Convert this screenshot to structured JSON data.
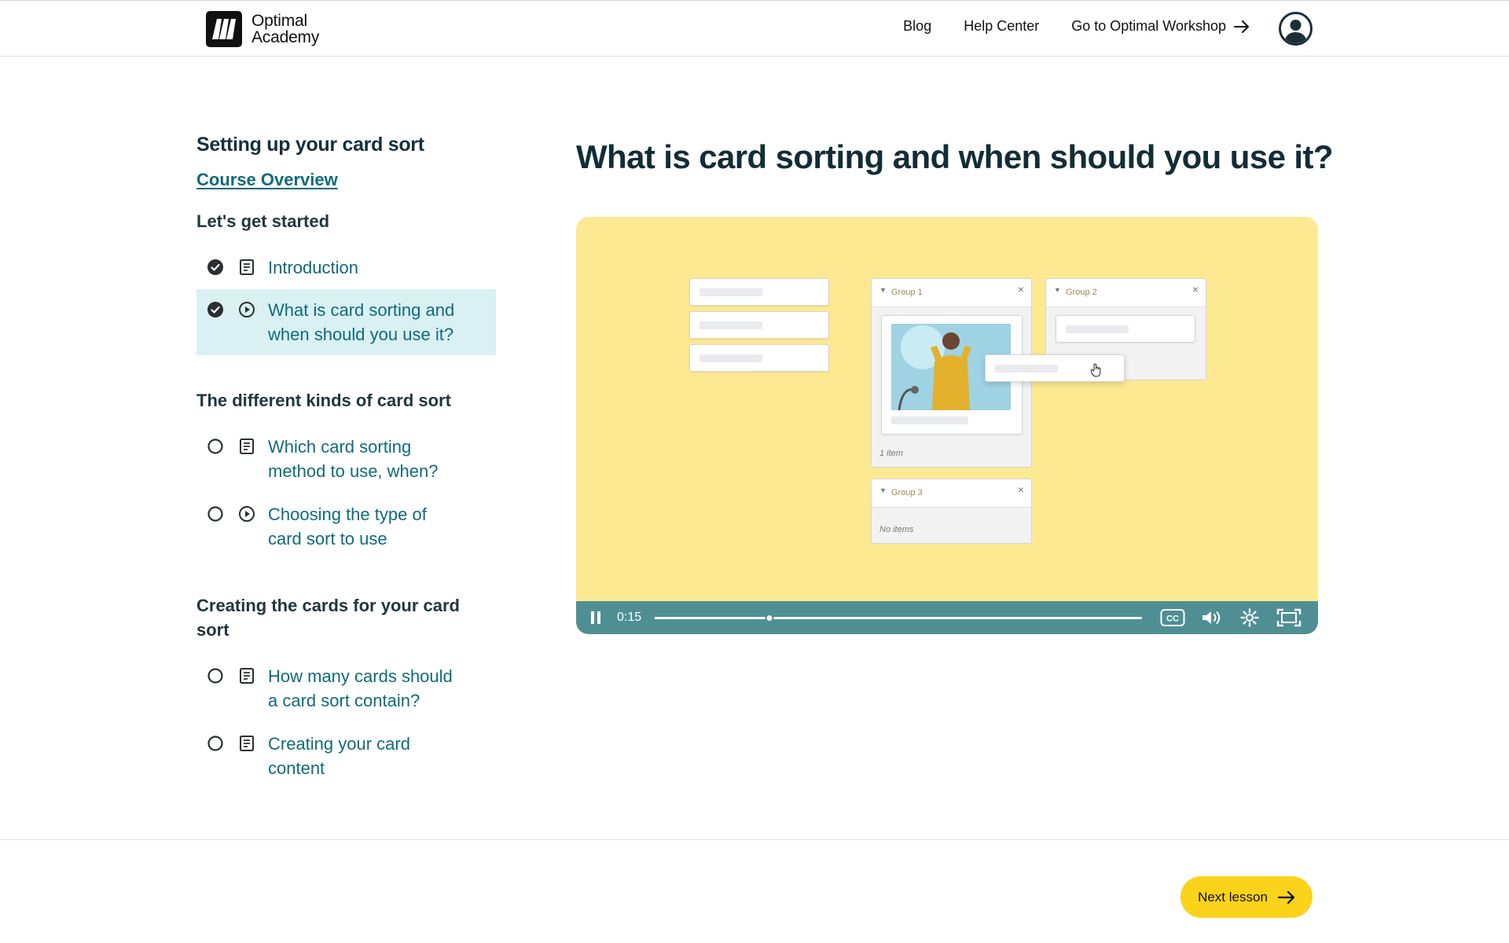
{
  "header": {
    "logo_line1": "Optimal",
    "logo_line2": "Academy",
    "nav": [
      {
        "label": "Blog"
      },
      {
        "label": "Help Center"
      },
      {
        "label": "Go to Optimal Workshop"
      }
    ]
  },
  "sidebar": {
    "course_title": "Setting up your card sort",
    "overview_link": "Course Overview",
    "sections": [
      {
        "title": "Let's get started",
        "lessons": [
          {
            "label": "Introduction",
            "status": "complete",
            "type": "article"
          },
          {
            "label": "What is card sorting and when should you use it?",
            "status": "complete",
            "type": "video",
            "active": true
          }
        ]
      },
      {
        "title": "The different kinds of card sort",
        "lessons": [
          {
            "label": "Which card sorting method to use, when?",
            "status": "incomplete",
            "type": "article"
          },
          {
            "label": "Choosing the type of card sort to use",
            "status": "incomplete",
            "type": "video"
          }
        ]
      },
      {
        "title": "Creating the cards for your card sort",
        "lessons": [
          {
            "label": "How many cards should a card sort contain?",
            "status": "incomplete",
            "type": "article"
          },
          {
            "label": "Creating your card content",
            "status": "incomplete",
            "type": "article"
          }
        ]
      }
    ]
  },
  "main": {
    "title": "What is card sorting and when should you use it?",
    "video": {
      "time": "0:15",
      "progress": 0.235,
      "groups": {
        "g1": "Group 1",
        "g1_count": "1 item",
        "g2": "Group 2",
        "g3": "Group 3",
        "g3_count": "No items"
      }
    }
  },
  "footer": {
    "next_label": "Next lesson"
  },
  "colors": {
    "accent_teal": "#0f6b7a",
    "active_bg": "#daf1f4",
    "video_bg": "#fde992",
    "controls_bg": "#4f8f93",
    "next_button": "#fbd31a"
  }
}
